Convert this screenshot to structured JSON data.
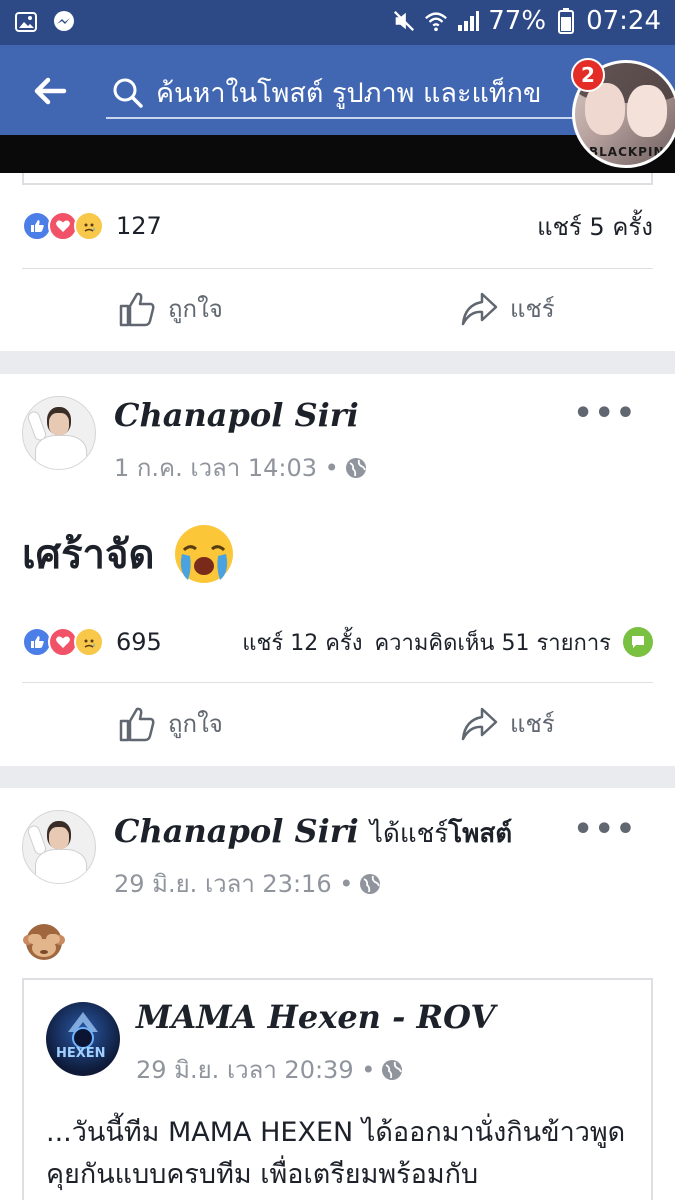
{
  "status_bar": {
    "battery": "77%",
    "time": "07:24"
  },
  "search": {
    "placeholder": "ค้นหาในโพสต์ รูปภาพ และแท็กข"
  },
  "chat_head": {
    "badge": "2",
    "caption": "BLACKPINK"
  },
  "post_top": {
    "reaction_count": "127",
    "share_count": "แชร์ 5 ครั้ง",
    "like_label": "ถูกใจ",
    "share_label": "แชร์"
  },
  "post1": {
    "author": "Chanapol Siri",
    "timestamp": "1 ก.ค. เวลา 14:03 •",
    "text": "เศร้าจัด",
    "reaction_count": "695",
    "share_count": "แชร์ 12 ครั้ง",
    "comment_count": "ความคิดเห็น 51 รายการ",
    "like_label": "ถูกใจ",
    "share_label": "แชร์"
  },
  "post2": {
    "author": "Chanapol Siri",
    "action": "ได้แชร์",
    "action_object": "โพสต์",
    "timestamp": "29 มิ.ย. เวลา 23:16 •",
    "emoji": "🙈",
    "shared": {
      "page_name": "MAMA Hexen - ROV",
      "page_avatar_label": "HEXEN",
      "timestamp": "29 มิ.ย. เวลา 20:39 •",
      "body": "...วันนี้ทีม MAMA HEXEN ได้ออกมานั่งกินข้าวพูดคุยกันแบบครบทีม เพื่อเตรียมพร้อมกับ"
    }
  },
  "colors": {
    "header": "#4267b2",
    "status_bar": "#2e4a86",
    "text_primary": "#1d2129",
    "text_secondary": "#90949c",
    "like": "#4c7ee8",
    "love": "#f25268",
    "comment": "#7ac142"
  }
}
